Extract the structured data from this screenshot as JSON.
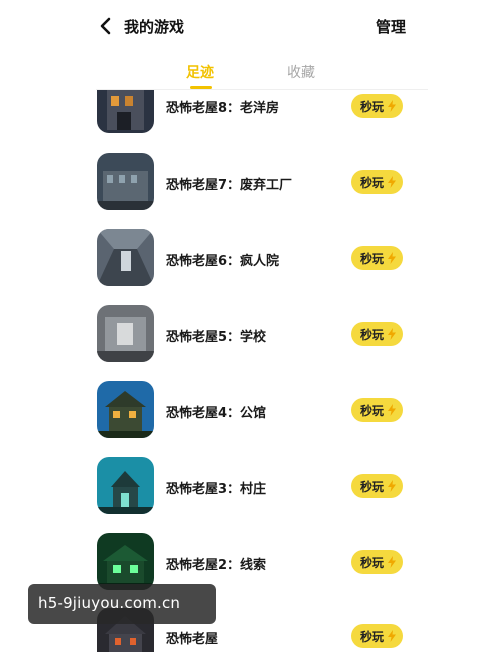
{
  "header": {
    "title": "我的游戏",
    "manage_label": "管理"
  },
  "tabs": [
    {
      "label": "足迹",
      "active": true
    },
    {
      "label": "收藏",
      "active": false
    }
  ],
  "games": [
    {
      "name": "恐怖老屋8：老洋房",
      "play_label": "秒玩"
    },
    {
      "name": "恐怖老屋7：废弃工厂",
      "play_label": "秒玩"
    },
    {
      "name": "恐怖老屋6：疯人院",
      "play_label": "秒玩"
    },
    {
      "name": "恐怖老屋5：学校",
      "play_label": "秒玩"
    },
    {
      "name": "恐怖老屋4：公馆",
      "play_label": "秒玩"
    },
    {
      "name": "恐怖老屋3：村庄",
      "play_label": "秒玩"
    },
    {
      "name": "恐怖老屋2：线索",
      "play_label": "秒玩"
    },
    {
      "name": "恐怖老屋",
      "play_label": "秒玩"
    }
  ],
  "watermark": "h5-9jiuyou.com.cn",
  "colors": {
    "accent": "#f2c200",
    "play_button": "#f5d93e",
    "inactive_tab": "#a7a7a7"
  }
}
